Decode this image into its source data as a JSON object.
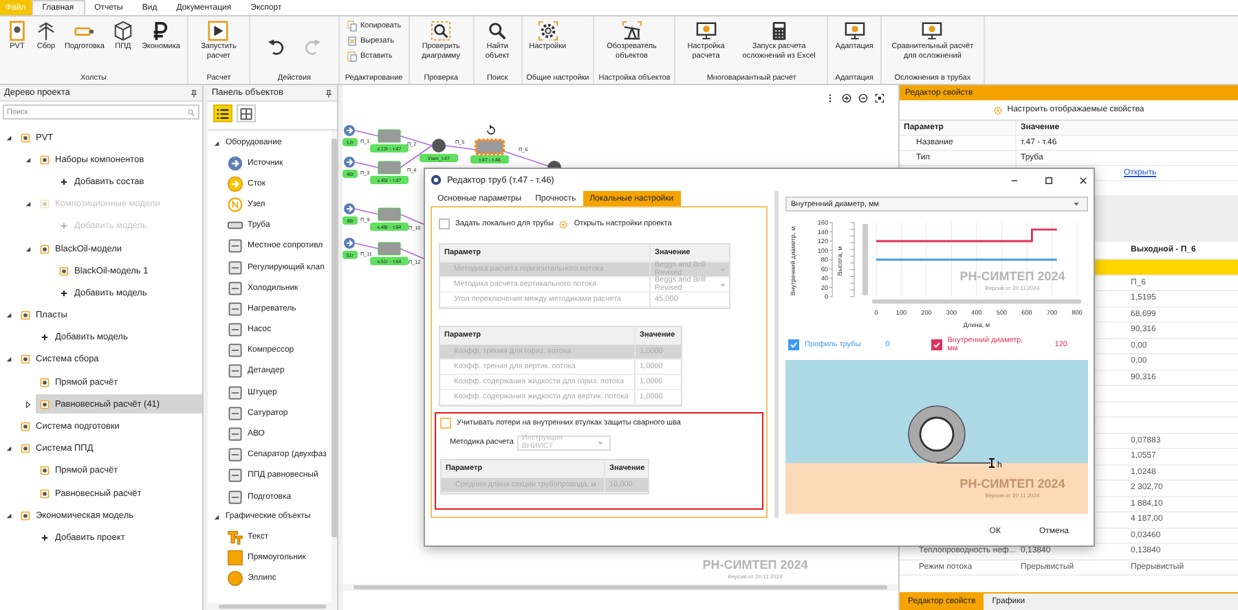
{
  "menu_tabs": [
    {
      "label": "Файл",
      "kind": "file",
      "selected": false
    },
    {
      "label": "Главная",
      "kind": "tab",
      "selected": true
    },
    {
      "label": "Отчеты",
      "kind": "tab",
      "selected": false
    },
    {
      "label": "Вид",
      "kind": "tab",
      "selected": false
    },
    {
      "label": "Документация",
      "kind": "tab",
      "selected": false
    },
    {
      "label": "Экспорт",
      "kind": "tab",
      "selected": false
    }
  ],
  "ribbon": [
    {
      "title": "Холсты",
      "kind": "large",
      "buttons": [
        {
          "label": "PVT"
        },
        {
          "label": "Сбор"
        },
        {
          "label": "Подготовка"
        },
        {
          "label": "ППД"
        },
        {
          "label": "Экономика"
        }
      ]
    },
    {
      "title": "Расчет",
      "kind": "large",
      "buttons": [
        {
          "label": "Запустить расчет"
        }
      ]
    },
    {
      "title": "Действия",
      "kind": "icons",
      "buttons": [
        {
          "disabled": false
        },
        {
          "disabled": true
        }
      ]
    },
    {
      "title": "Редактирование",
      "kind": "small",
      "buttons": [
        {
          "label": "Копировать"
        },
        {
          "label": "Вырезать"
        },
        {
          "label": "Вставить"
        }
      ]
    },
    {
      "title": "Проверка",
      "kind": "large",
      "buttons": [
        {
          "label": "Проверить диаграмму"
        }
      ]
    },
    {
      "title": "Поиск",
      "kind": "large",
      "buttons": [
        {
          "label": "Найти объект"
        }
      ]
    },
    {
      "title": "Общие настройки",
      "kind": "large",
      "buttons": [
        {
          "label": "Настройки"
        }
      ]
    },
    {
      "title": "Настройка объектов",
      "kind": "large",
      "buttons": [
        {
          "label": "Обозреватель объектов"
        }
      ]
    },
    {
      "title": "Многовариантный расчет",
      "kind": "large",
      "buttons": [
        {
          "label": "Настройка расчета"
        },
        {
          "label": "Запуск расчета осложнений из Excel"
        }
      ]
    },
    {
      "title": "Адаптация",
      "kind": "large",
      "buttons": [
        {
          "label": "Адаптация"
        }
      ]
    },
    {
      "title": "Осложнения в трубах",
      "kind": "large",
      "buttons": [
        {
          "label": "Сравнительный расчёт для осложнений"
        }
      ]
    }
  ],
  "project_tree": {
    "title": "Дерево проекта",
    "search": {
      "placeholder": "Поиск"
    },
    "items": [
      {
        "label": "PVT",
        "kind": "item",
        "selected": false,
        "expanded": true,
        "children": [
          {
            "label": "Наборы компонентов",
            "kind": "item",
            "selected": false,
            "expanded": true,
            "children": [
              {
                "label": "Добавить состав",
                "kind": "add",
                "selected": false
              }
            ]
          },
          {
            "label": "Композиционные модели",
            "kind": "item",
            "selected": false,
            "disabled": true,
            "expanded": true,
            "children": [
              {
                "label": "Добавить модель",
                "kind": "add",
                "selected": false,
                "disabled": true
              }
            ]
          },
          {
            "label": "BlackOil-модели",
            "kind": "item",
            "selected": false,
            "expanded": true,
            "children": [
              {
                "label": "BlackOil-модель 1",
                "kind": "item",
                "selected": false
              },
              {
                "label": "Добавить модель",
                "kind": "add",
                "selected": false
              }
            ]
          }
        ]
      },
      {
        "label": "Пласты",
        "kind": "item",
        "selected": false,
        "expanded": true,
        "children": [
          {
            "label": "Добавить модель",
            "kind": "add",
            "selected": false
          }
        ]
      },
      {
        "label": "Система сбора",
        "kind": "item",
        "selected": false,
        "expanded": true,
        "children": [
          {
            "label": "Прямой расчёт",
            "kind": "item",
            "selected": false
          },
          {
            "label": "Равновесный расчёт (41)",
            "kind": "item",
            "selected": true,
            "expanded": false
          }
        ]
      },
      {
        "label": "Система подготовки",
        "kind": "item",
        "selected": false
      },
      {
        "label": "Система ППД",
        "kind": "item",
        "selected": false,
        "expanded": true,
        "children": [
          {
            "label": "Прямой расчёт",
            "kind": "item",
            "selected": false
          },
          {
            "label": "Равновесный расчёт",
            "kind": "item",
            "selected": false
          }
        ]
      },
      {
        "label": "Экономическая модель",
        "kind": "item",
        "selected": false,
        "expanded": true,
        "children": [
          {
            "label": "Добавить проект",
            "kind": "add",
            "selected": false
          }
        ]
      }
    ]
  },
  "objects_panel": {
    "title": "Панель объектов",
    "views": [
      {
        "kind": "list",
        "selected": true
      },
      {
        "kind": "grid",
        "selected": false
      }
    ],
    "groups": [
      {
        "title": "Оборудование",
        "expanded": true,
        "items": [
          "Источник",
          "Сток",
          "Узел",
          "Труба",
          "Местное сопротивл",
          "Регулирующий клап",
          "Холодильник",
          "Нагреватель",
          "Насос",
          "Компрессор",
          "Детандер",
          "Штуцер",
          "Сатуратор",
          "АВО",
          "Сепаратор (двухфаз",
          "ППД равновесный",
          "Подготовка"
        ]
      },
      {
        "title": "Графические объекты",
        "expanded": true,
        "items": [
          "Текст",
          "Прямоугольник",
          "Эллипс"
        ]
      }
    ]
  },
  "canvas": {
    "wells": [
      {
        "source": "12г",
        "in_pipe": "П_1",
        "block": "к.12г - т.47",
        "out_pipe": "П_2"
      },
      {
        "source": "40г",
        "in_pipe": "П_3",
        "block": "к.40г - т.47",
        "out_pipe": "П_4"
      },
      {
        "source": "48г",
        "in_pipe": "П_9",
        "block": "к.48г - т.64",
        "out_pipe": "П_10"
      },
      {
        "source": "51г",
        "in_pipe": "П_11",
        "block": "к.51г - т.64",
        "out_pipe": "П_12"
      }
    ],
    "node": "Узел_т.47",
    "selected_pipe": {
      "in_pipe": "П_5",
      "label": "т.47 - т.46",
      "out_pipe": "П_6",
      "selected": true
    },
    "watermark": {
      "title": "РН-СИМТЕП 2024",
      "version": "Версия от 20.11.2024"
    }
  },
  "properties": {
    "title": "Редактор свойств",
    "customize": "Настроить отображаемые свойства",
    "columns": [
      "Параметр",
      "Значение"
    ],
    "rows": [
      {
        "parameter": "Название",
        "value": "т.47 - т.46"
      },
      {
        "parameter": "Тип",
        "value": "Труба"
      },
      {
        "link": "Открыть"
      },
      {}
    ],
    "results": {
      "column_3": "Выходной - П_6",
      "rows": [
        {
          "kind": "group"
        },
        {
          "kind": "row",
          "column_3": "П_6"
        },
        {
          "kind": "row",
          "column_3": "1,5195"
        },
        {
          "kind": "row",
          "column_3": "68,699"
        },
        {
          "kind": "row",
          "column_3": "90,316"
        },
        {
          "kind": "row",
          "column_3": "0,00"
        },
        {
          "kind": "row",
          "column_3": "0,00"
        },
        {
          "kind": "row",
          "column_3": "90,316"
        },
        {
          "kind": "row"
        },
        {
          "kind": "row"
        },
        {
          "kind": "row"
        },
        {
          "kind": "row",
          "column_3": "0,07883"
        },
        {
          "kind": "row",
          "column_3": "1,0557"
        },
        {
          "kind": "row",
          "column_3": "1,0248"
        },
        {
          "kind": "row",
          "column_3": "2 302,70"
        },
        {
          "kind": "row",
          "column_3": "1 884,10"
        },
        {
          "kind": "row",
          "column_3": "4 187,00"
        },
        {
          "kind": "row",
          "column_3": "0,03460"
        },
        {
          "kind": "row",
          "column_1": "Теплопроводность неф...",
          "column_2": "0,13840",
          "column_3": "0,13840"
        },
        {
          "kind": "row",
          "column_1": "Режим потока",
          "column_2": "Прерывистый",
          "column_3": "Прерывистый"
        }
      ]
    },
    "tabs": [
      {
        "label": "Редактор свойств",
        "selected": true
      },
      {
        "label": "Графики",
        "selected": false
      }
    ]
  },
  "pipe_editor": {
    "title": "Редактор труб (т.47 - т.46)",
    "tabs": [
      {
        "label": "Основные параметры",
        "selected": false
      },
      {
        "label": "Прочность",
        "selected": false
      },
      {
        "label": "Локальные настройки",
        "selected": true
      }
    ],
    "local_for_pipe": {
      "label": "Задать локально для трубы",
      "checked": false
    },
    "open_settings": "Открыть настройки проекта",
    "tables": [
      {
        "columns": [
          "Параметр",
          "Значение"
        ],
        "rows": [
          {
            "parameter": "Методика расчета горизонтального потока",
            "value": "Beggs and Brill Revised",
            "kind": "dropdown",
            "selected": true
          },
          {
            "parameter": "Методика расчета вертикального потока",
            "value": "Beggs and Brill Revised",
            "kind": "dropdown",
            "selected": false
          },
          {
            "parameter": "Угол переключения между методиками расчета",
            "value": "45,000",
            "kind": "number",
            "selected": false
          }
        ]
      },
      {
        "columns": [
          "Параметр",
          "Значение"
        ],
        "rows": [
          {
            "parameter": "Коэфф. трения для гориз. потока",
            "value": "1,0000",
            "kind": "number",
            "selected": true
          },
          {
            "parameter": "Коэфф. трения для вертик. потока",
            "value": "1,0000",
            "kind": "number",
            "selected": false
          },
          {
            "parameter": "Коэфф. содержания жидкости для гориз. потока",
            "value": "1,0000",
            "kind": "number",
            "selected": false
          },
          {
            "parameter": "Коэфф. содержания жидкости для вертик. потока",
            "value": "1,0000",
            "kind": "number",
            "selected": false
          }
        ]
      }
    ],
    "weld": {
      "highlighted": true,
      "label": "Учитывать потери на внутренних втулках защиты сварного шва",
      "checked": false,
      "method_label": "Методика расчета",
      "method": "Инструкция ВНИИСТ",
      "table": {
        "columns": [
          "Параметр",
          "Значение"
        ],
        "rows": [
          {
            "parameter": "Средняя длина секции трубопровода, м",
            "value": "10,000",
            "selected": true
          }
        ]
      }
    },
    "chart_select": "Внутренний диаметр,  мм",
    "chart": {
      "watermark": {
        "title": "РН-СИМТЕП 2024",
        "version": "Версия от 20.11.2024"
      },
      "chart_data": {
        "type": "line",
        "xlabel": "Длина, м",
        "ylabel": "Внутренний диаметр, м",
        "y2label": "Высота, м",
        "x": [
          0,
          620,
          620,
          720
        ],
        "xlim": [
          0,
          800
        ],
        "ylim": [
          0,
          160
        ],
        "grid": true,
        "ref_lines": [
          {
            "axis": "y",
            "value": 80,
            "color": "#3d9af0"
          }
        ],
        "xticks": [
          0,
          100,
          200,
          300,
          400,
          500,
          600,
          700,
          800
        ],
        "yticks": [
          0,
          20,
          40,
          60,
          80,
          100,
          120,
          140,
          160
        ],
        "series": [
          {
            "name": "Внутренний диаметр, мм",
            "color": "#e0305a",
            "values": [
              120,
              120,
              145,
              145
            ]
          }
        ]
      }
    },
    "legend": [
      {
        "label": "Профиль трубы",
        "color": "#3d9af0",
        "reading": "0",
        "checked": true
      },
      {
        "reading": "120",
        "checked": true
      }
    ],
    "cross_section": {
      "marker": "h",
      "watermark": {
        "title": "РН-СИМТЕП 2024",
        "version": "Версия от 20.11.2024"
      }
    },
    "buttons": [
      "ОК",
      "Отмена"
    ]
  }
}
